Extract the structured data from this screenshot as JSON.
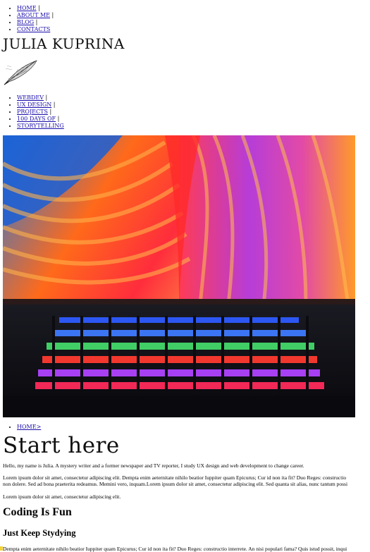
{
  "top_nav": {
    "items": [
      {
        "label": "HOME",
        "sep": " |"
      },
      {
        "label": "ABOUT ME",
        "sep": " |"
      },
      {
        "label": "BLOG",
        "sep": " |"
      },
      {
        "label": "CONTACTS",
        "sep": ""
      }
    ]
  },
  "site": {
    "title": "JULIA KUPRINA",
    "logo_icon": "feather-quill-icon"
  },
  "category_nav": {
    "items": [
      {
        "label": "WEBDEV",
        "sep": " |"
      },
      {
        "label": "UX DESIGN",
        "sep": " |"
      },
      {
        "label": "PROJECTS",
        "sep": " |"
      },
      {
        "label": "100 DAYS OF",
        "sep": " |"
      },
      {
        "label": "STORYTELLING",
        "sep": ""
      }
    ]
  },
  "breadcrumb": {
    "label": "HOME>"
  },
  "main": {
    "heading": "Start here",
    "paragraphs": [
      "Hello, my name is Julia. A mystery writer and a former newspaper and TV reporter, I study UX design and web development to change career.",
      "Lorem ipsum dolor sit amet, consectetur adipiscing elit. Dempta enim aeternitate nihilo beatior Iuppiter quam Epicurus; Cur id non ita fit? Duo Reges: constructio",
      "non dolere. Sed ad bona praeterita redeamus. Memini vero, inquam.Lorem ipsum dolor sit amet, consectetur adipiscing elit. Sed quanta sit alias, nunc tantum possi",
      "Lorem ipsum dolor sit amet, consectetur adipiscing elit."
    ],
    "section_heading": "Coding Is Fun",
    "sub_heading": "Just Keep Stydying",
    "last_paragraph": "Dempta enim aeternitate nihilo beatior Iuppiter quam Epicurus; Cur id non ita fit? Duo Reges: constructio interrete. An nisi populari fama? Quis istud possit, inqui"
  }
}
